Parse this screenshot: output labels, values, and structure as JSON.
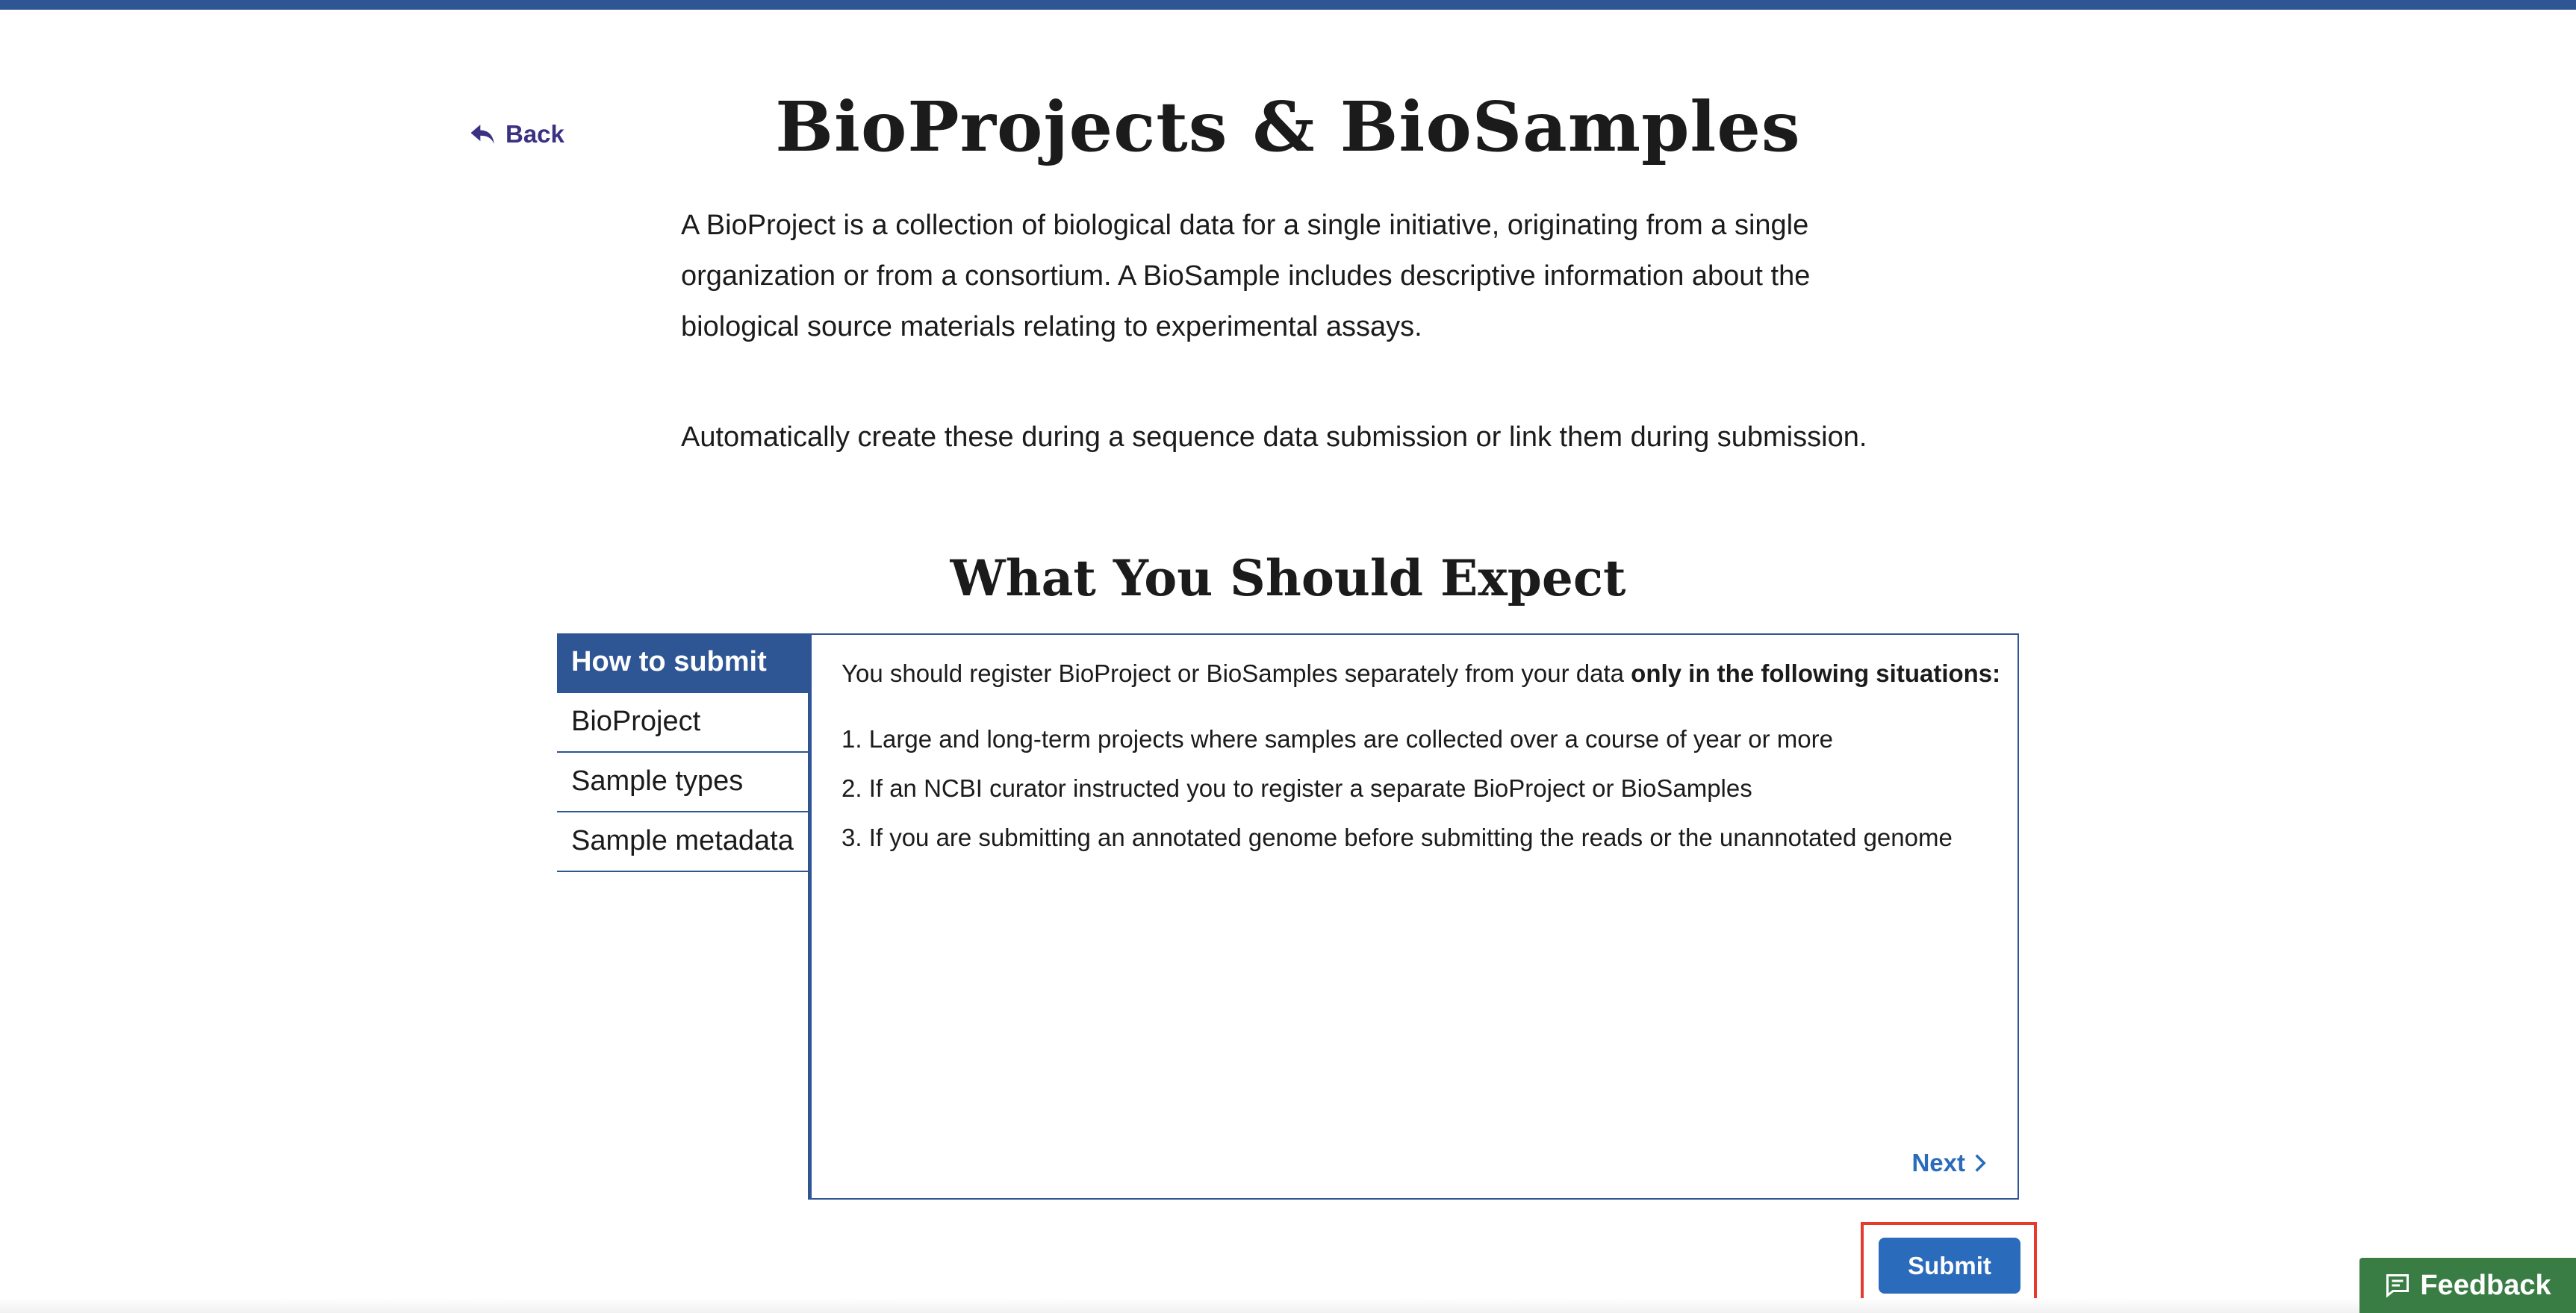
{
  "header": {
    "back_label": "Back",
    "title": "BioProjects & BioSamples"
  },
  "intro": {
    "paragraph_1": "A BioProject is a collection of biological data for a single initiative, originating from a single organization or from a consortium. A BioSample includes descriptive information about the biological source materials relating to experimental assays.",
    "paragraph_2": "Automatically create these during a sequence data submission or link them during submission."
  },
  "expect": {
    "title": "What You Should Expect",
    "tabs": [
      {
        "label": "How to submit",
        "active": true
      },
      {
        "label": "BioProject",
        "active": false
      },
      {
        "label": "Sample types",
        "active": false
      },
      {
        "label": "Sample metadata",
        "active": false
      }
    ],
    "lead_text": "You should register BioProject or BioSamples separately from your data ",
    "lead_bold": "only in the following situations:",
    "points": [
      "1. Large and long-term projects where samples are collected over a course of year or more",
      "2. If an NCBI curator instructed you to register a separate BioProject or BioSamples",
      "3. If you are submitting an annotated genome before submitting the reads or the unannotated genome"
    ],
    "next_label": "Next"
  },
  "actions": {
    "submit_label": "Submit",
    "feedback_label": "Feedback"
  },
  "colors": {
    "primary_blue": "#2e5594",
    "link_blue": "#2a6bbb",
    "back_purple": "#3a3183",
    "highlight_red": "#e53a2e",
    "feedback_green": "#3a7d44"
  },
  "icons": {
    "back": "reply-arrow-icon",
    "next": "chevron-right-icon",
    "feedback": "chat-bubble-icon"
  }
}
